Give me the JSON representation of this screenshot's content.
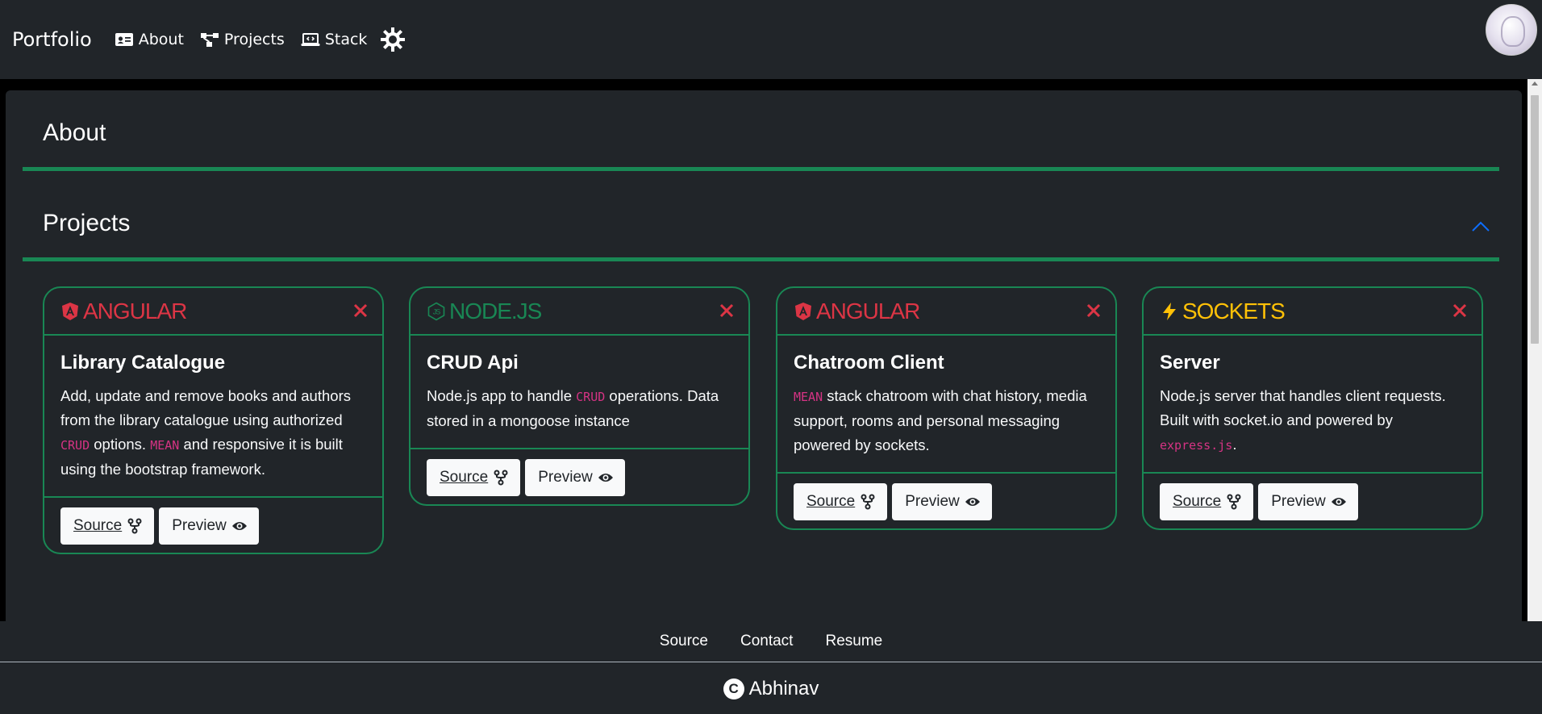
{
  "nav": {
    "brand": "Portfolio",
    "links": [
      {
        "label": "About",
        "icon": "id-card-icon"
      },
      {
        "label": "Projects",
        "icon": "diagram-icon"
      },
      {
        "label": "Stack",
        "icon": "laptop-code-icon"
      }
    ],
    "theme_icon": "sun-gear-icon",
    "avatar_icon": "avatar"
  },
  "sections": {
    "about": "About",
    "projects": "Projects"
  },
  "colors": {
    "accent": "#198754",
    "angular": "#dc3545",
    "node": "#198754",
    "sockets": "#ffc107",
    "code": "#d63384",
    "close": "#dc3545",
    "chevron": "#0d6efd"
  },
  "cards": [
    {
      "tech": "ANGULAR",
      "title": "Library Catalogue",
      "text_parts": [
        "Add, update and remove books and authors from the library catalogue using authorized ",
        "CRUD",
        " options. ",
        "MEAN",
        " and responsive it is built using the bootstrap framework."
      ],
      "source": "Source",
      "preview": "Preview"
    },
    {
      "tech": "NODE.JS",
      "title": "CRUD Api",
      "text_parts": [
        "Node.js app to handle ",
        "CRUD",
        " operations. Data stored in a mongoose instance"
      ],
      "source": "Source",
      "preview": "Preview"
    },
    {
      "tech": "ANGULAR",
      "title": "Chatroom Client",
      "text_parts": [
        "MEAN",
        " stack chatroom with chat history, media support, rooms and personal messaging powered by sockets."
      ],
      "source": "Source",
      "preview": "Preview"
    },
    {
      "tech": "SOCKETS",
      "title": "Server",
      "text_parts": [
        "Node.js server that handles client requests. Built with socket.io and powered by ",
        "express.js",
        "."
      ],
      "source": "Source",
      "preview": "Preview"
    }
  ],
  "footer": {
    "links": [
      "Source",
      "Contact",
      "Resume"
    ],
    "copyright_icon": "C",
    "name": "Abhinav"
  }
}
